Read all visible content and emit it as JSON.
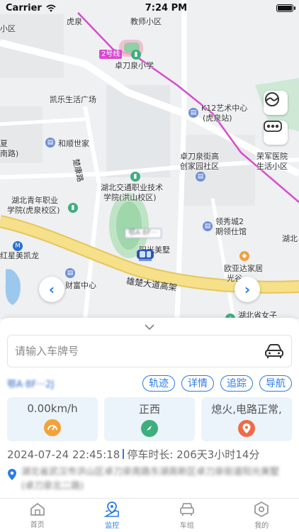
{
  "status_bar": {
    "carrier": "Carrier",
    "time": "7:24 PM"
  },
  "map": {
    "labels": {
      "huquan": "虎泉",
      "teacher_community": "教师小区",
      "small_district": "小区",
      "metro_line2": "2号线",
      "zhuodaoquan_school": "卓刀泉小学",
      "kaile_plaza": "凯乐生活广场",
      "k12_center_1": "K12艺术中心",
      "k12_center_2": "(虎泉站)",
      "summer": "夏",
      "south_road": "南路)",
      "heshun": "和顺世家",
      "chukang_road": "楚康路",
      "zhuodaoquan_street_1": "卓刀泉街高",
      "zhuodaoquan_street_2": "创家园社区",
      "rongjun_1": "荣军医院",
      "rongjun_2": "生活小区",
      "traffic_college_1": "湖北交通职业技术",
      "traffic_college_2": "学院(洪山校区)",
      "youth_college_1": "湖北青年职业",
      "youth_college_2": "学院(虎泉校区)",
      "lingxiu_1": "领秀城2",
      "lingxiu_2": "期领仕馆",
      "hubei_right": "湖北",
      "hongxing": "红星美凯龙",
      "yangguang": "阳光美墅",
      "ouya_1": "欧亚达家居",
      "ouya_2": "光谷",
      "caifu": "财富中心",
      "xiongchu": "雄楚大道高架",
      "women_hospital": "湖北省女子"
    },
    "car_tag": "鄂A·8F···"
  },
  "panel": {
    "search_placeholder": "请输入车牌号",
    "plate": "鄂A·8F···2J",
    "actions": [
      "轨迹",
      "详情",
      "追踪",
      "导航"
    ],
    "speed": "0.00km/h",
    "direction": "正西",
    "status": "熄火,电路正常,",
    "timestamp": "2024-07-24 22:45:18",
    "parking": "停车时长: 206天3小时14分",
    "address": "湖北省武汉市洪山区卓刀泉南路东湖高新区卓刀泉街道阳光美墅(卓刀泉北二路)"
  },
  "tabbar": {
    "items": [
      {
        "label": "首页",
        "icon": "home-icon"
      },
      {
        "label": "监控",
        "icon": "map-pin-icon"
      },
      {
        "label": "车组",
        "icon": "car-icon"
      },
      {
        "label": "我的",
        "icon": "profile-icon"
      }
    ],
    "active_index": 1
  },
  "colors": {
    "accent": "#2a7be4",
    "card_bg": "#ebf3fb",
    "metro": "#d84bd0",
    "expressway": "#f3d976"
  }
}
